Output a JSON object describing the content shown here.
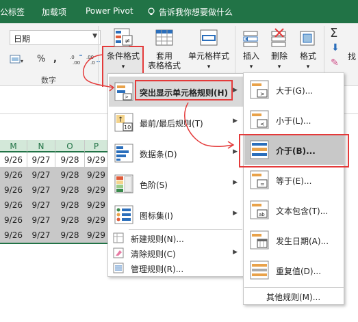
{
  "tabs": [
    "公标签",
    "加载项",
    "Power Pivot",
    "告诉我你想要做什么"
  ],
  "ribbon": {
    "font_name": "日期",
    "percent": "%",
    "comma": ",",
    "dec_up": ".0→.00",
    "dec_down": ".00→.0",
    "number_group_label": "数字",
    "cond_format_label": "条件格式",
    "table_format_label": "套用\n表格格式",
    "cell_style_label": "单元格样式",
    "insert_label": "插入",
    "delete_label": "删除",
    "format_label": "格式",
    "cut_label": "找"
  },
  "grid": {
    "columns": [
      "M",
      "N",
      "O",
      "P"
    ],
    "row0": [
      "9/26",
      "9/27",
      "9/28",
      "9/29"
    ],
    "rows": [
      [
        "9/26",
        "9/27",
        "9/28",
        "9/29"
      ],
      [
        "9/26",
        "9/27",
        "9/28",
        "9/29"
      ],
      [
        "9/26",
        "9/27",
        "9/28",
        "9/29"
      ],
      [
        "9/26",
        "9/27",
        "9/28",
        "9/29"
      ],
      [
        "9/26",
        "9/27",
        "9/28",
        "9/29"
      ]
    ]
  },
  "menu": {
    "items": [
      {
        "label": "突出显示单元格规则(H)"
      },
      {
        "label": "最前/最后规则(T)"
      },
      {
        "label": "数据条(D)"
      },
      {
        "label": "色阶(S)"
      },
      {
        "label": "图标集(I)"
      }
    ],
    "small_items": [
      {
        "label": "新建规则(N)..."
      },
      {
        "label": "清除规则(C)"
      },
      {
        "label": "管理规则(R)..."
      }
    ]
  },
  "submenu": {
    "items": [
      {
        "label": "大于(G)..."
      },
      {
        "label": "小于(L)..."
      },
      {
        "label": "介于(B)..."
      },
      {
        "label": "等于(E)..."
      },
      {
        "label": "文本包含(T)..."
      },
      {
        "label": "发生日期(A)..."
      },
      {
        "label": "重复值(D)..."
      }
    ],
    "more_label": "其他规则(M)..."
  },
  "colors": {
    "tab_green": "#217346",
    "annotation_red": "#e43a3a",
    "shade_gray": "#c8c8c8"
  }
}
